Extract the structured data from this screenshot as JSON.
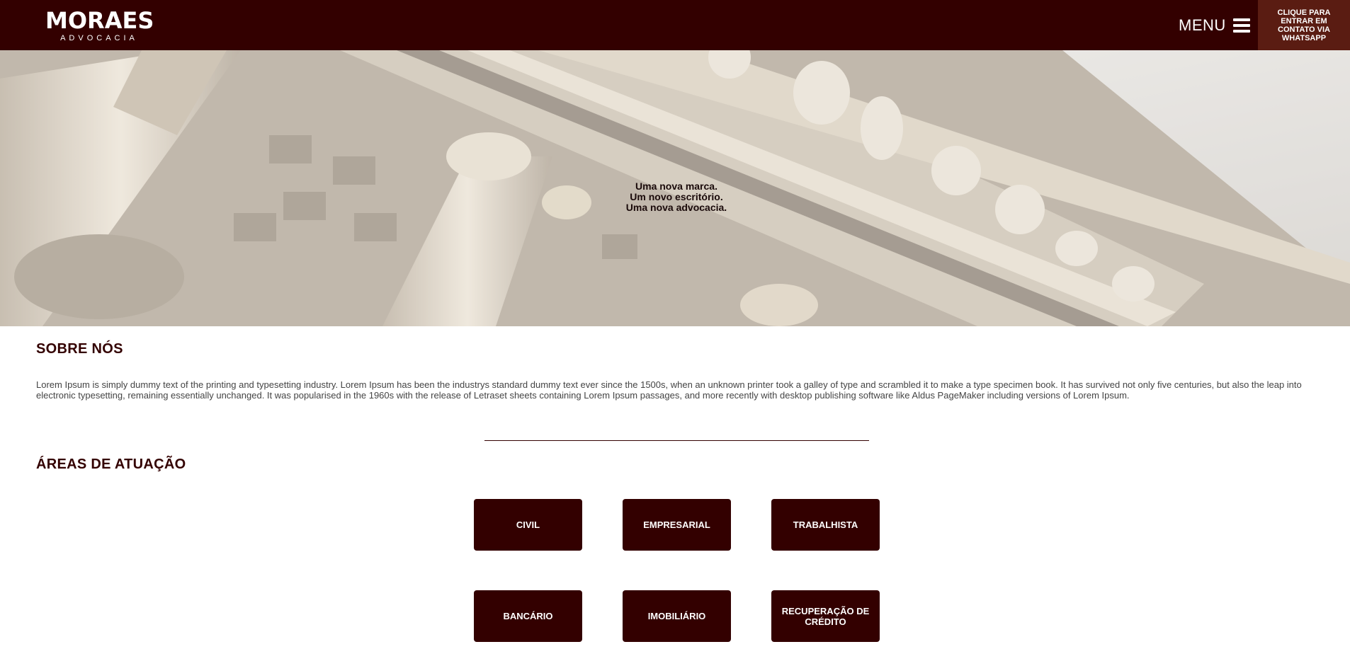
{
  "header": {
    "logo_main": "MORAES",
    "logo_sub": "ADVOCACIA",
    "menu_label": "MENU",
    "whatsapp_cta": "CLIQUE PARA ENTRAR EM CONTATO VIA WHATSAPP",
    "background_color": "#330000",
    "cta_color": "#5a1c12"
  },
  "hero": {
    "line1": "Uma nova marca.",
    "line2": "Um novo escritório.",
    "line3": "Uma nova advocacia."
  },
  "about": {
    "title": "SOBRE NÓS",
    "text": "Lorem Ipsum is simply dummy text of the printing and typesetting industry. Lorem Ipsum has been the industrys standard dummy text ever since the 1500s, when an unknown printer took a galley of type and scrambled it to make a type specimen book. It has survived not only five centuries, but also the leap into electronic typesetting, remaining essentially unchanged. It was popularised in the 1960s with the release of Letraset sheets containing Lorem Ipsum passages, and more recently with desktop publishing software like Aldus PageMaker including versions of Lorem Ipsum."
  },
  "areas": {
    "title": "ÁREAS DE ATUAÇÃO",
    "items": [
      {
        "label": "CIVIL"
      },
      {
        "label": "EMPRESARIAL"
      },
      {
        "label": "TRABALHISTA"
      },
      {
        "label": "BANCÁRIO"
      },
      {
        "label": "IMOBILIÁRIO"
      },
      {
        "label": "RECUPERAÇÃO DE CRÉDITO"
      }
    ]
  }
}
